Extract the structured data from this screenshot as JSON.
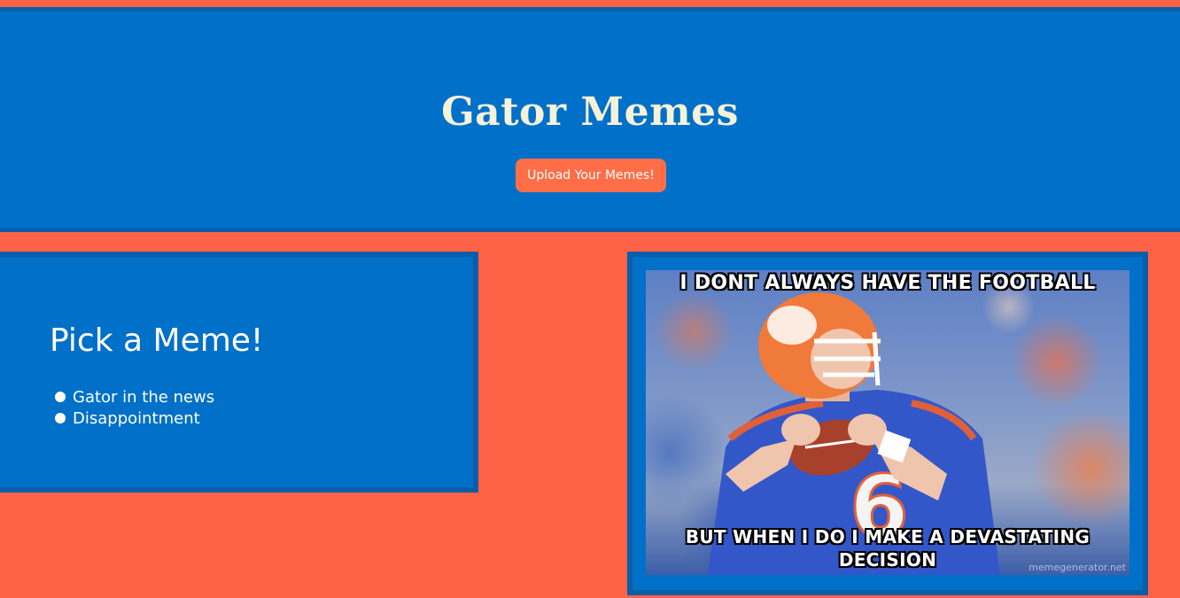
{
  "header": {
    "title": "Gator Memes",
    "upload_button_label": "Upload Your Memes!"
  },
  "picker": {
    "title": "Pick a Meme!",
    "items": [
      {
        "label": "Gator in the news"
      },
      {
        "label": "Disappointment"
      }
    ]
  },
  "meme": {
    "top_text": "I DONT ALWAYS HAVE THE FOOTBALL",
    "bottom_text": "BUT WHEN I DO I MAKE A DEVASTATING DECISION",
    "watermark": "memegenerator.net",
    "jersey_number": "6"
  },
  "colors": {
    "background": "#ff6347",
    "panel_blue": "#0070c8",
    "panel_border": "#0a5ea8",
    "title_cream": "#f6f2d9",
    "button_orange": "#ff6e47"
  }
}
